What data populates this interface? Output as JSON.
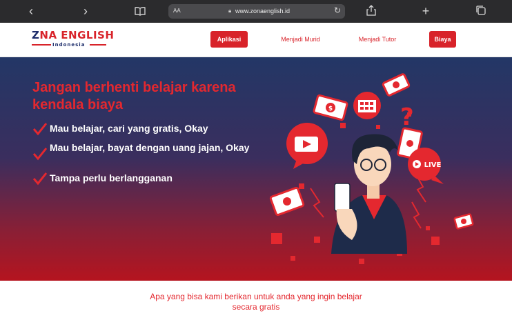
{
  "browser": {
    "text_size_label": "AA",
    "url": "www.zonaenglish.id",
    "icons": [
      "back-icon",
      "forward-icon",
      "book-icon",
      "lock-icon",
      "reload-icon",
      "share-icon",
      "new-tab-icon",
      "tabs-icon"
    ]
  },
  "header": {
    "logo_part1": "Z",
    "logo_part2": "NA",
    "logo_part3": " ENGLISH",
    "logo_sub": "Indonesia",
    "nav": [
      {
        "label": "Aplikasi",
        "style": "filled"
      },
      {
        "label": "Menjadi Murid",
        "style": "text"
      },
      {
        "label": "Menjadi Tutor",
        "style": "text"
      },
      {
        "label": "Biaya",
        "style": "filled"
      }
    ]
  },
  "hero": {
    "title": "Jangan berhenti belajar karena kendala biaya",
    "points": [
      "Mau belajar, cari yang gratis, Okay",
      "Mau belajar, bayat dengan uang jajan, Okay",
      "Tampa perlu berlangganan"
    ],
    "live_label": "LIVE"
  },
  "section": {
    "subtitle": "Apa yang bisa kami berikan untuk anda yang ingin belajar secara gratis"
  },
  "colors": {
    "brand_red": "#d8232a",
    "brand_navy": "#1d2d6b",
    "hero_top": "#233766",
    "hero_bottom": "#b5141f"
  }
}
